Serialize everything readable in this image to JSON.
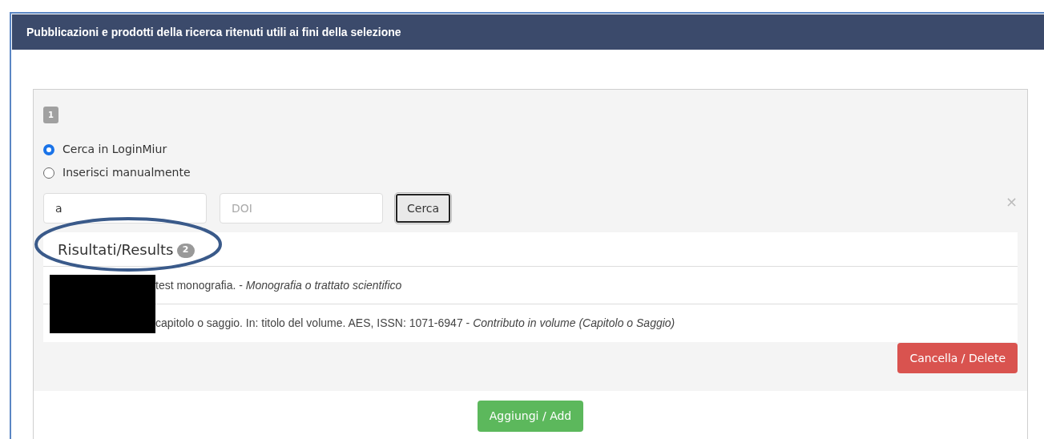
{
  "header": {
    "title": "Pubblicazioni e prodotti della ricerca ritenuti utili ai fini della selezione"
  },
  "item": {
    "number": "1",
    "options": [
      {
        "label": "Cerca in LoginMiur",
        "selected": true
      },
      {
        "label": "Inserisci manualmente",
        "selected": false
      }
    ],
    "search_field": {
      "value": "a"
    },
    "doi_field": {
      "placeholder": "DOI"
    },
    "search_button": "Cerca",
    "close": "×",
    "results": {
      "title": "Risultati/Results",
      "count": "2",
      "highlighted": true,
      "rows": [
        {
          "text": "test monografia. - *Monografia o trattato scientifico*"
        },
        {
          "text": "capitolo o saggio. In: titolo del volume. AES, ISSN: 1071-6947 - *Contributo in volume (Capitolo o Saggio)*"
        }
      ]
    },
    "delete_button": "Cancella / Delete"
  },
  "add_button": "Aggiungi / Add"
}
